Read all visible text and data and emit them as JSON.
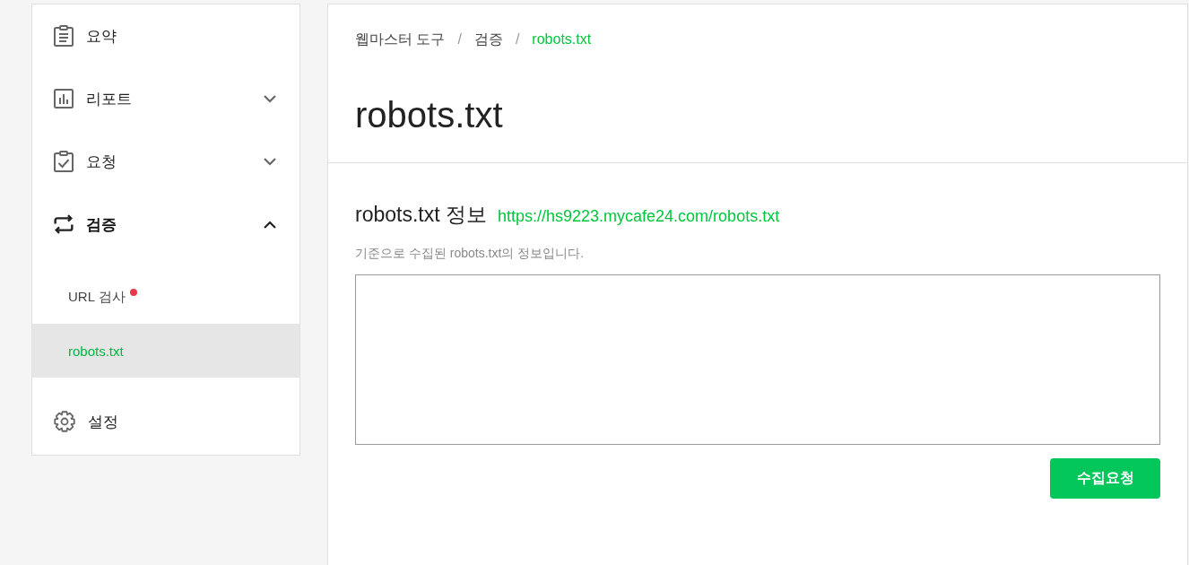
{
  "sidebar": {
    "nav": [
      {
        "kind": "link",
        "label": "요약",
        "selected": false
      },
      {
        "kind": "group",
        "label": "리포트",
        "selected": false,
        "expanded": false
      },
      {
        "kind": "group",
        "label": "요청",
        "selected": false,
        "expanded": false
      },
      {
        "kind": "group",
        "label": "검증",
        "selected": true,
        "expanded": true,
        "children": [
          {
            "label": "URL 검사",
            "selected": false,
            "notice": true
          },
          {
            "label": "robots.txt",
            "selected": true,
            "notice": false
          }
        ]
      },
      {
        "kind": "link",
        "label": "설정",
        "selected": false
      }
    ]
  },
  "breadcrumb": {
    "separator": "/",
    "items": [
      {
        "label": "웹마스터 도구",
        "current": false
      },
      {
        "label": "검증",
        "current": false
      },
      {
        "label": "robots.txt",
        "current": true
      }
    ]
  },
  "page_title": "robots.txt",
  "section": {
    "heading": "robots.txt 정보",
    "url": "https://hs9223.mycafe24.com/robots.txt",
    "description": "기준으로 수집된 robots.txt의 정보입니다.",
    "button": "수집요청"
  }
}
